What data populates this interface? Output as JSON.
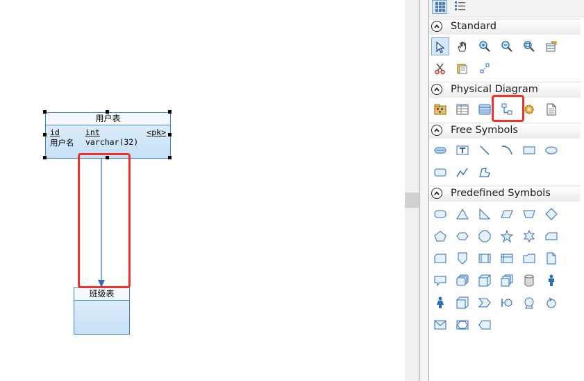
{
  "diagram": {
    "table_user": {
      "title": "用户表",
      "columns": [
        {
          "name": "id",
          "type": "int",
          "key": "<pk>"
        },
        {
          "name": "用户名",
          "type": "varchar(32)",
          "key": ""
        }
      ]
    },
    "table_class": {
      "title": "班级表"
    }
  },
  "palette": {
    "sections": {
      "standard": "Standard",
      "physical": "Physical Diagram",
      "free": "Free Symbols",
      "predefined": "Predefined Symbols"
    }
  },
  "colors": {
    "highlight": "#f0302a",
    "table_border": "#3a86c8",
    "table_fill": "#c6e0f6",
    "icon_blue": "#2c6fb7"
  }
}
